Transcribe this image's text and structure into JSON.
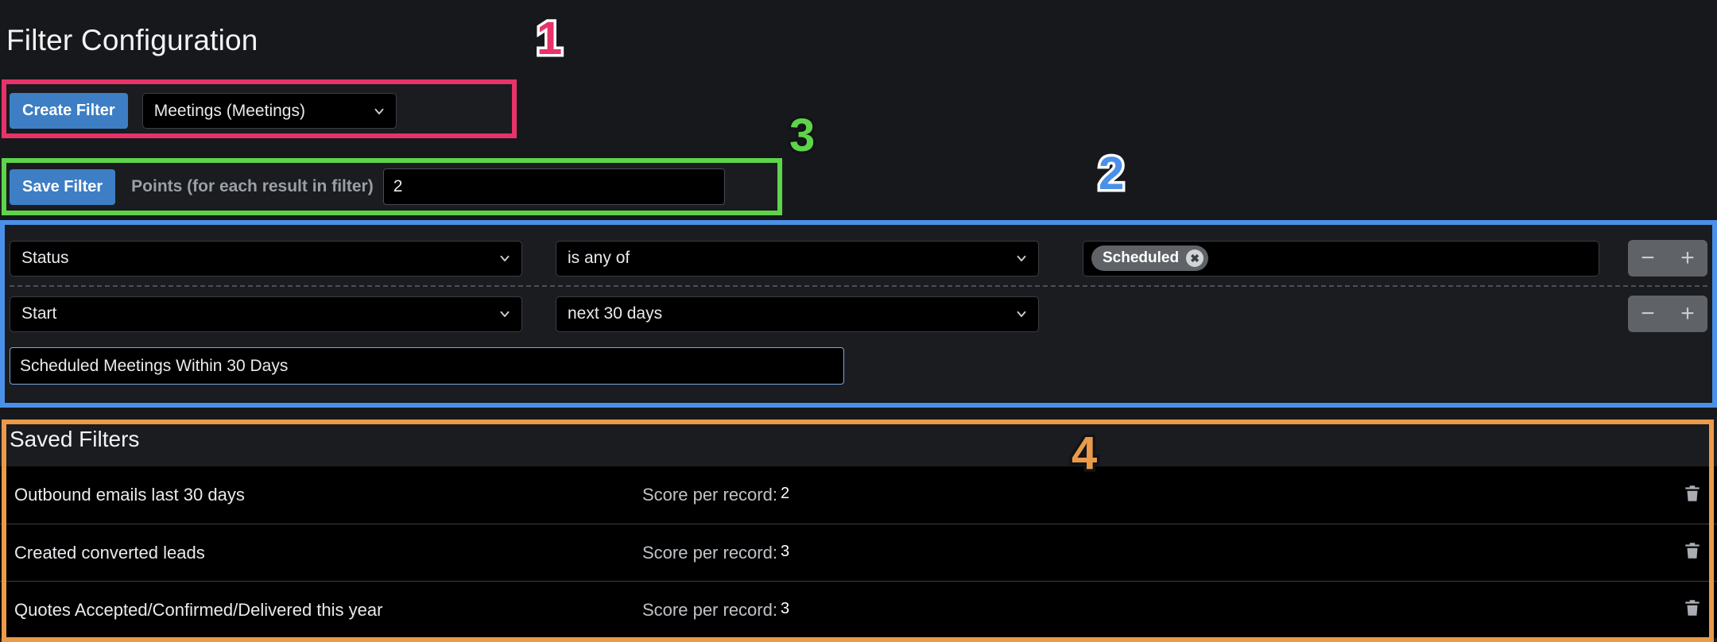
{
  "header": {
    "title": "Filter Configuration"
  },
  "create_row": {
    "create_button": "Create Filter",
    "entity_select_value": "Meetings (Meetings)",
    "chevron_icon": "chevron-down-icon"
  },
  "save_row": {
    "save_button": "Save Filter",
    "points_label": "Points (for each result in filter)",
    "points_value": "2",
    "points_placeholder": "Points"
  },
  "conditions": {
    "rows": [
      {
        "field": "Status",
        "operator": "is any of",
        "value_chips": [
          {
            "label": "Scheduled",
            "remove_icon": "close-circle-icon"
          }
        ],
        "minus_label": "−",
        "plus_label": "+"
      },
      {
        "field": "Start",
        "operator": "next 30 days",
        "value_chips": [],
        "minus_label": "−",
        "plus_label": "+"
      }
    ],
    "filter_name_value": "Scheduled Meetings Within 30 Days",
    "filter_name_placeholder": "Filter name"
  },
  "saved_filters": {
    "title": "Saved Filters",
    "score_label": "Score per record:",
    "delete_icon": "trash-icon",
    "items": [
      {
        "name": "Outbound emails last 30 days",
        "score": "2"
      },
      {
        "name": "Created converted leads",
        "score": "3"
      },
      {
        "name": "Quotes Accepted/Confirmed/Delivered this year",
        "score": "3"
      }
    ]
  },
  "annotations": [
    {
      "number": "1",
      "color": "#e8336a"
    },
    {
      "number": "2",
      "color": "#4a90e8"
    },
    {
      "number": "3",
      "color": "#5ed44a"
    },
    {
      "number": "4",
      "color": "#eb9a4a"
    }
  ],
  "colors": {
    "accent_blue": "#3d7ec4",
    "anno_pink": "#e8336a",
    "anno_blue": "#4a90e8",
    "anno_green": "#5ed44a",
    "anno_orange": "#eb9a4a",
    "panel_bg": "#1a1c20",
    "input_bg": "#000000"
  }
}
